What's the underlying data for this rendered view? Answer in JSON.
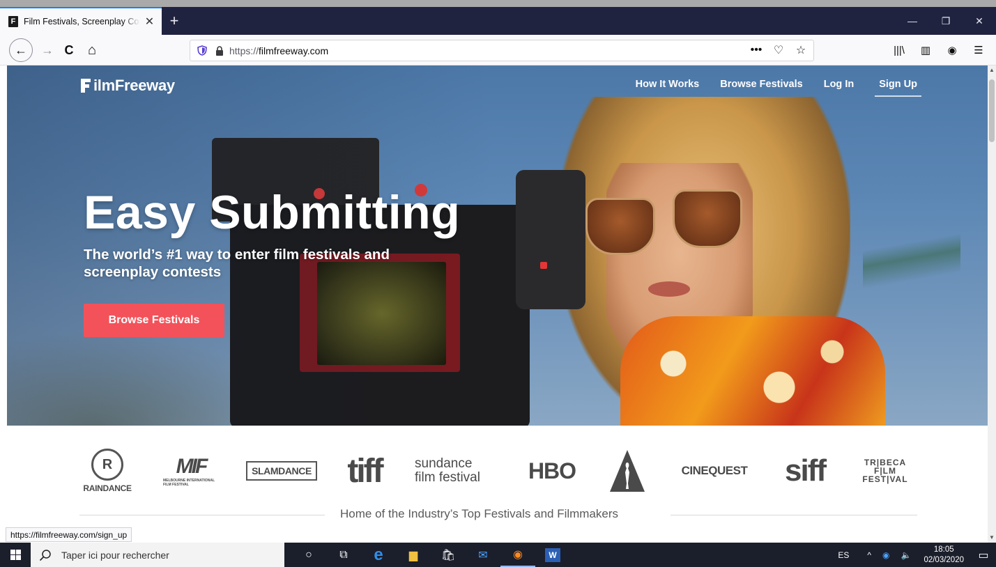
{
  "browser": {
    "tab": {
      "favicon": "F",
      "title": "Film Festivals, Screenplay Contests",
      "close": "✕"
    },
    "new_tab": "+",
    "window": {
      "minimize": "—",
      "restore": "❐",
      "close": "✕"
    },
    "nav": {
      "back": "←",
      "forward": "→",
      "reload": "C",
      "home": "⌂"
    },
    "url": {
      "prefix": "https://",
      "domain": "filmfreeway.com"
    },
    "url_actions": {
      "more": "•••",
      "pocket": "♡",
      "bookmark": "☆"
    },
    "toolbar_right": {
      "library": "|||\\",
      "sidebar": "▥",
      "account": "◉",
      "menu": "☰"
    }
  },
  "page": {
    "logo_text": "ilmFreeway",
    "nav": {
      "how_it_works": "How It Works",
      "browse_festivals": "Browse Festivals",
      "login": "Log In",
      "signup": "Sign Up"
    },
    "hero": {
      "headline": "Easy Submitting",
      "subhead": "The world’s #1 way to enter film festivals and screenplay contests",
      "cta": "Browse Festivals"
    },
    "logos": {
      "raindance": "RAINDANCE",
      "raindance_mark": "R",
      "miff": "MIF",
      "miff_small": "MELBOURNE INTERNATIONAL FILM FESTIVAL",
      "slamdance": "SLAMDANCE",
      "tiff": "tiff",
      "sundance_1": "sundance",
      "sundance_2": "film festival",
      "hbo": "HBO",
      "cinequest": "CINEQUEST",
      "siff": "siff",
      "tribeca_1": "TR|BECA",
      "tribeca_2": "F|LM",
      "tribeca_3": "FEST|VAL"
    },
    "tagline": "Home of the Industry’s Top Festivals and Filmmakers"
  },
  "status_bar": {
    "url": "https://filmfreeway.com/sign_up"
  },
  "taskbar": {
    "search_placeholder": "Taper ici pour rechercher",
    "icons": {
      "cortana": "○",
      "taskview": "⧉",
      "edge": "e",
      "explorer": "▆",
      "store": "🛍",
      "mail": "✉",
      "firefox": "◉",
      "word": "W"
    },
    "tray": {
      "lang": "ES",
      "chevron": "^",
      "network": "◉",
      "volume": "🔈",
      "time": "18:05",
      "date": "02/03/2020",
      "notifications": "▭"
    }
  },
  "colors": {
    "accent_tab": "#0a84ff",
    "cta": "#f3525a",
    "tabbar": "#202340",
    "taskbar": "#1b1e2b"
  }
}
